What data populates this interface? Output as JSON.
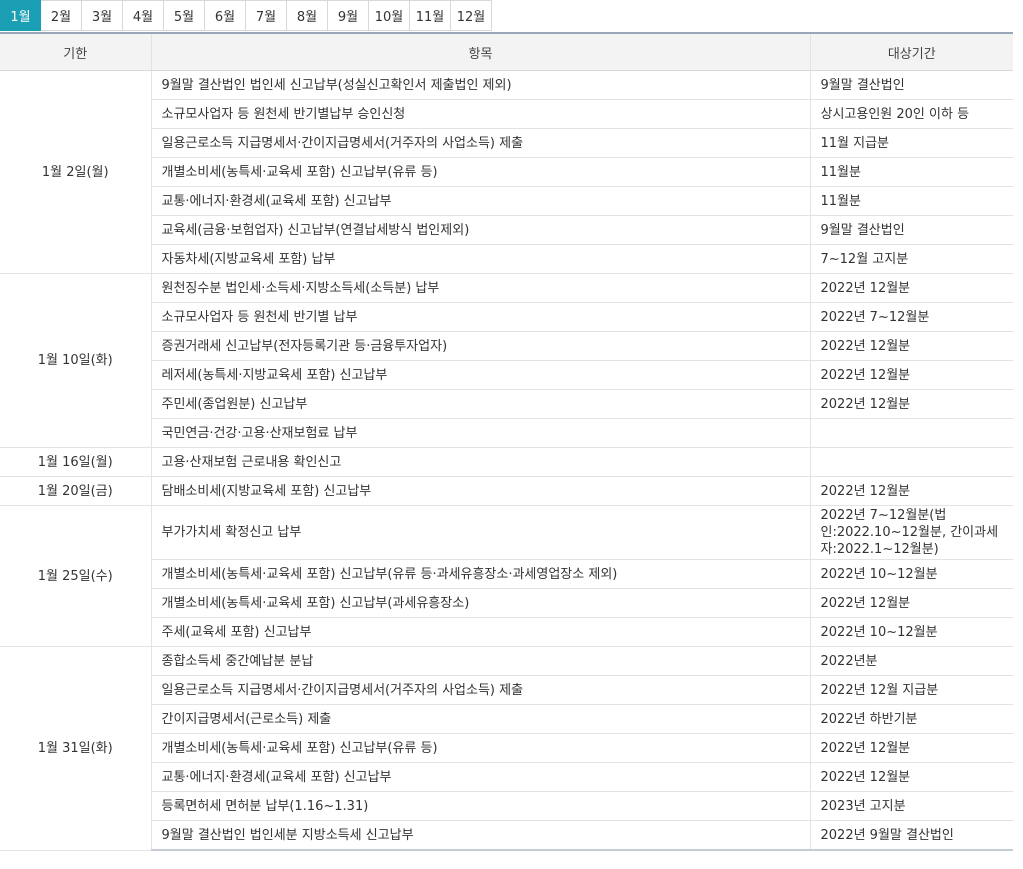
{
  "tabs": [
    {
      "label": "1월",
      "active": true
    },
    {
      "label": "2월",
      "active": false
    },
    {
      "label": "3월",
      "active": false
    },
    {
      "label": "4월",
      "active": false
    },
    {
      "label": "5월",
      "active": false
    },
    {
      "label": "6월",
      "active": false
    },
    {
      "label": "7월",
      "active": false
    },
    {
      "label": "8월",
      "active": false
    },
    {
      "label": "9월",
      "active": false
    },
    {
      "label": "10월",
      "active": false
    },
    {
      "label": "11월",
      "active": false
    },
    {
      "label": "12월",
      "active": false
    }
  ],
  "columns": {
    "deadline": "기한",
    "item": "항목",
    "period": "대상기간"
  },
  "groups": [
    {
      "date": "1월 2일(월)",
      "rows": [
        {
          "item": "9월말 결산법인 법인세 신고납부(성실신고확인서 제출법인 제외)",
          "period": "9월말 결산법인"
        },
        {
          "item": "소규모사업자 등 원천세 반기별납부 승인신청",
          "period": "상시고용인원 20인 이하 등"
        },
        {
          "item": "일용근로소득 지급명세서·간이지급명세서(거주자의 사업소득) 제출",
          "period": "11월 지급분"
        },
        {
          "item": "개별소비세(농특세·교육세 포함) 신고납부(유류 등)",
          "period": "11월분"
        },
        {
          "item": "교통·에너지·환경세(교육세 포함) 신고납부",
          "period": "11월분"
        },
        {
          "item": "교육세(금융·보험업자) 신고납부(연결납세방식 법인제외)",
          "period": "9월말 결산법인"
        },
        {
          "item": "자동차세(지방교육세 포함) 납부",
          "period": "7~12월 고지분"
        }
      ]
    },
    {
      "date": "1월 10일(화)",
      "rows": [
        {
          "item": "원천징수분 법인세·소득세·지방소득세(소득분) 납부",
          "period": "2022년 12월분"
        },
        {
          "item": "소규모사업자 등 원천세 반기별 납부",
          "period": "2022년 7~12월분"
        },
        {
          "item": "증권거래세 신고납부(전자등록기관 등·금융투자업자)",
          "period": "2022년 12월분"
        },
        {
          "item": "레저세(농특세·지방교육세 포함) 신고납부",
          "period": "2022년 12월분"
        },
        {
          "item": "주민세(종업원분) 신고납부",
          "period": "2022년 12월분"
        },
        {
          "item": "국민연금·건강·고용·산재보험료 납부",
          "period": ""
        }
      ]
    },
    {
      "date": "1월 16일(월)",
      "rows": [
        {
          "item": "고용·산재보험 근로내용 확인신고",
          "period": ""
        }
      ]
    },
    {
      "date": "1월 20일(금)",
      "rows": [
        {
          "item": "담배소비세(지방교육세 포함) 신고납부",
          "period": "2022년 12월분"
        }
      ]
    },
    {
      "date": "1월 25일(수)",
      "rows": [
        {
          "item": "부가가치세 확정신고 납부",
          "period": "2022년 7~12월분(법인:2022.10~12월분, 간이과세자:2022.1~12월분)"
        },
        {
          "item": "개별소비세(농특세·교육세 포함) 신고납부(유류 등·과세유흥장소·과세영업장소 제외)",
          "period": "2022년 10~12월분"
        },
        {
          "item": "개별소비세(농특세·교육세 포함) 신고납부(과세유흥장소)",
          "period": "2022년 12월분"
        },
        {
          "item": "주세(교육세 포함) 신고납부",
          "period": "2022년 10~12월분"
        }
      ]
    },
    {
      "date": "1월 31일(화)",
      "rows": [
        {
          "item": "종합소득세 중간예납분 분납",
          "period": "2022년분"
        },
        {
          "item": "일용근로소득 지급명세서·간이지급명세서(거주자의 사업소득) 제출",
          "period": "2022년 12월 지급분"
        },
        {
          "item": "간이지급명세서(근로소득) 제출",
          "period": "2022년 하반기분"
        },
        {
          "item": "개별소비세(농특세·교육세 포함) 신고납부(유류 등)",
          "period": "2022년 12월분"
        },
        {
          "item": "교통·에너지·환경세(교육세 포함) 신고납부",
          "period": "2022년 12월분"
        },
        {
          "item": "등록면허세 면허분 납부(1.16~1.31)",
          "period": "2023년 고지분"
        },
        {
          "item": "9월말 결산법인 법인세분 지방소득세 신고납부",
          "period": "2022년 9월말 결산법인"
        }
      ]
    }
  ]
}
